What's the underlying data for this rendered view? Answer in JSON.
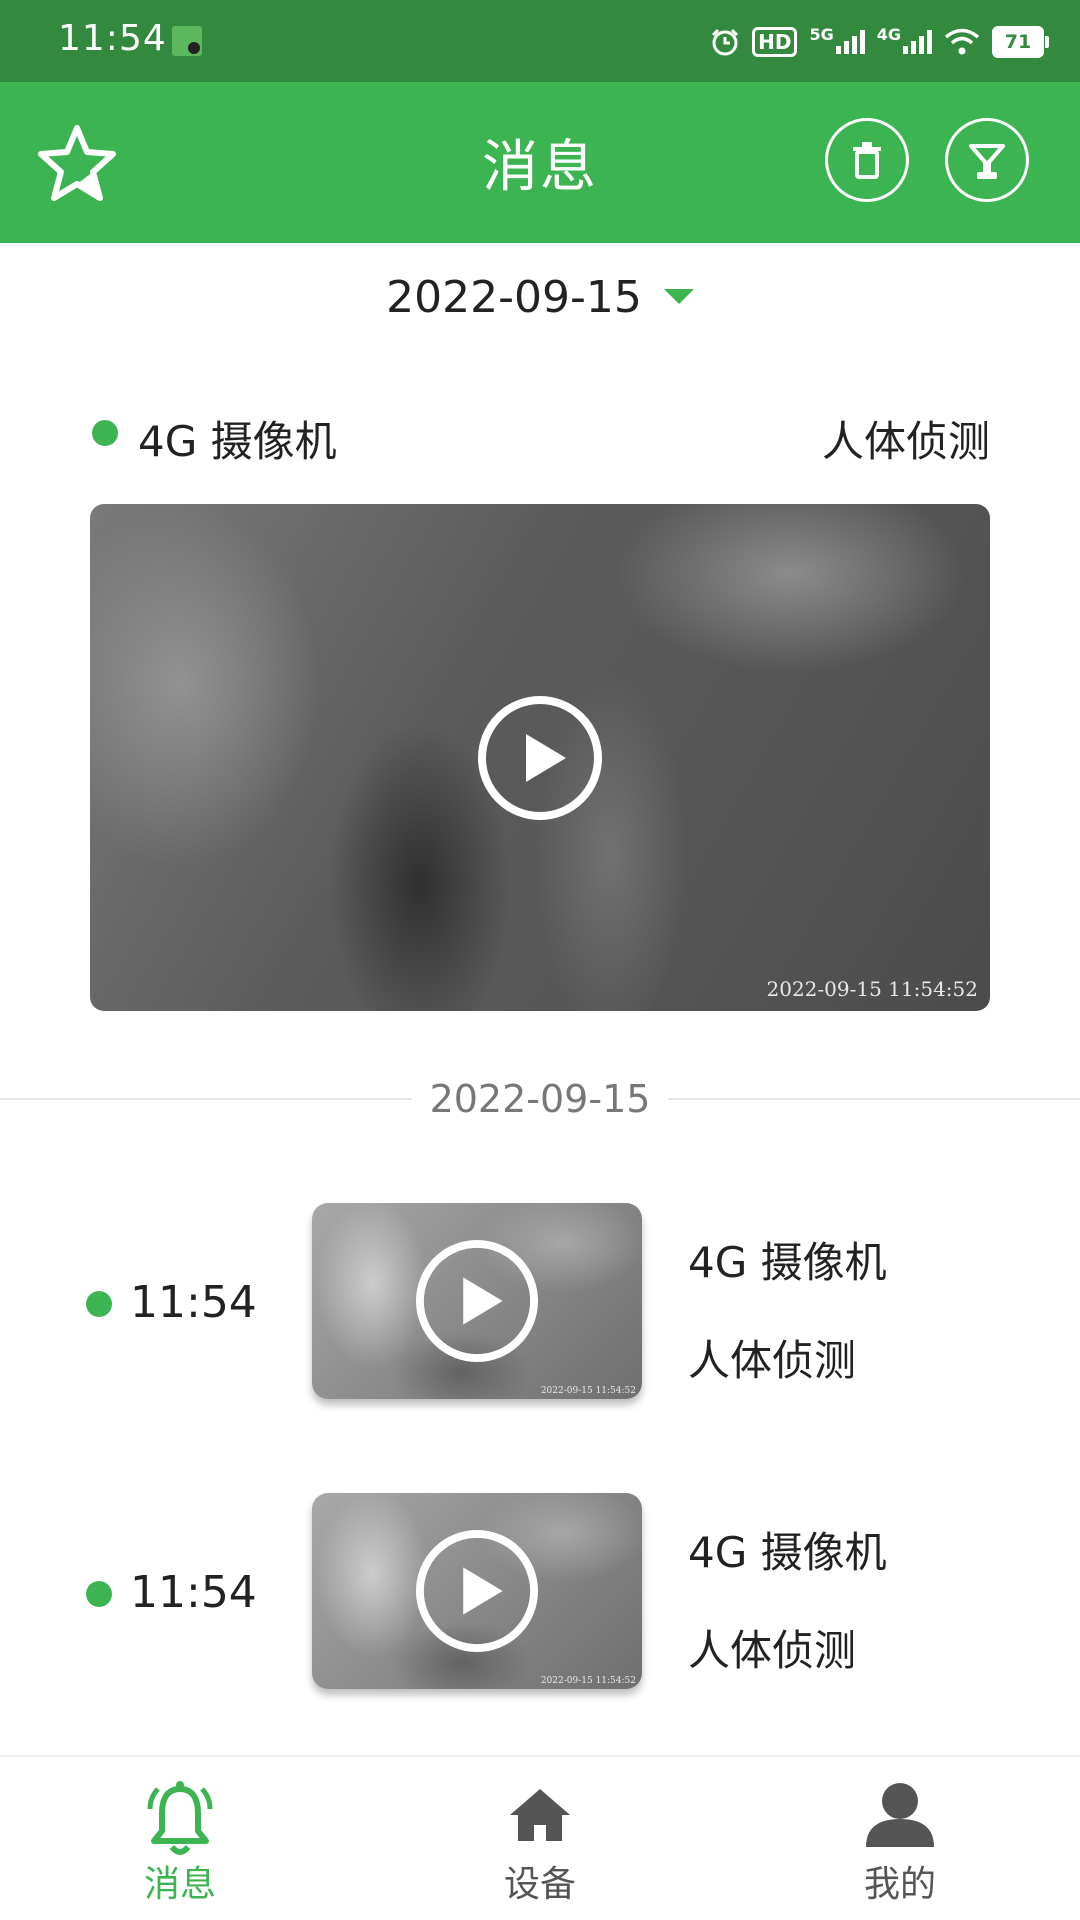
{
  "status_bar": {
    "time": "11:54",
    "hd": "HD",
    "net1": "5G",
    "net2": "4G",
    "battery": "71"
  },
  "header": {
    "title": "消息"
  },
  "date_filter": {
    "value": "2022-09-15"
  },
  "featured": {
    "device": "4G 摄像机",
    "event_type": "人体侦测",
    "timestamp": "2022-09-15 11:54:52"
  },
  "group": {
    "date": "2022-09-15"
  },
  "events": [
    {
      "time": "11:54",
      "device": "4G 摄像机",
      "event_type": "人体侦测",
      "timestamp": "2022-09-15 11:54:52"
    },
    {
      "time": "11:54",
      "device": "4G 摄像机",
      "event_type": "人体侦测",
      "timestamp": "2022-09-15 11:54:52"
    }
  ],
  "bottom_nav": {
    "items": [
      {
        "label": "消息",
        "icon": "bell-icon",
        "active": true
      },
      {
        "label": "设备",
        "icon": "home-icon",
        "active": false
      },
      {
        "label": "我的",
        "icon": "person-icon",
        "active": false
      }
    ]
  },
  "colors": {
    "brand": "#3cb452",
    "status_bar": "#338a3e"
  }
}
